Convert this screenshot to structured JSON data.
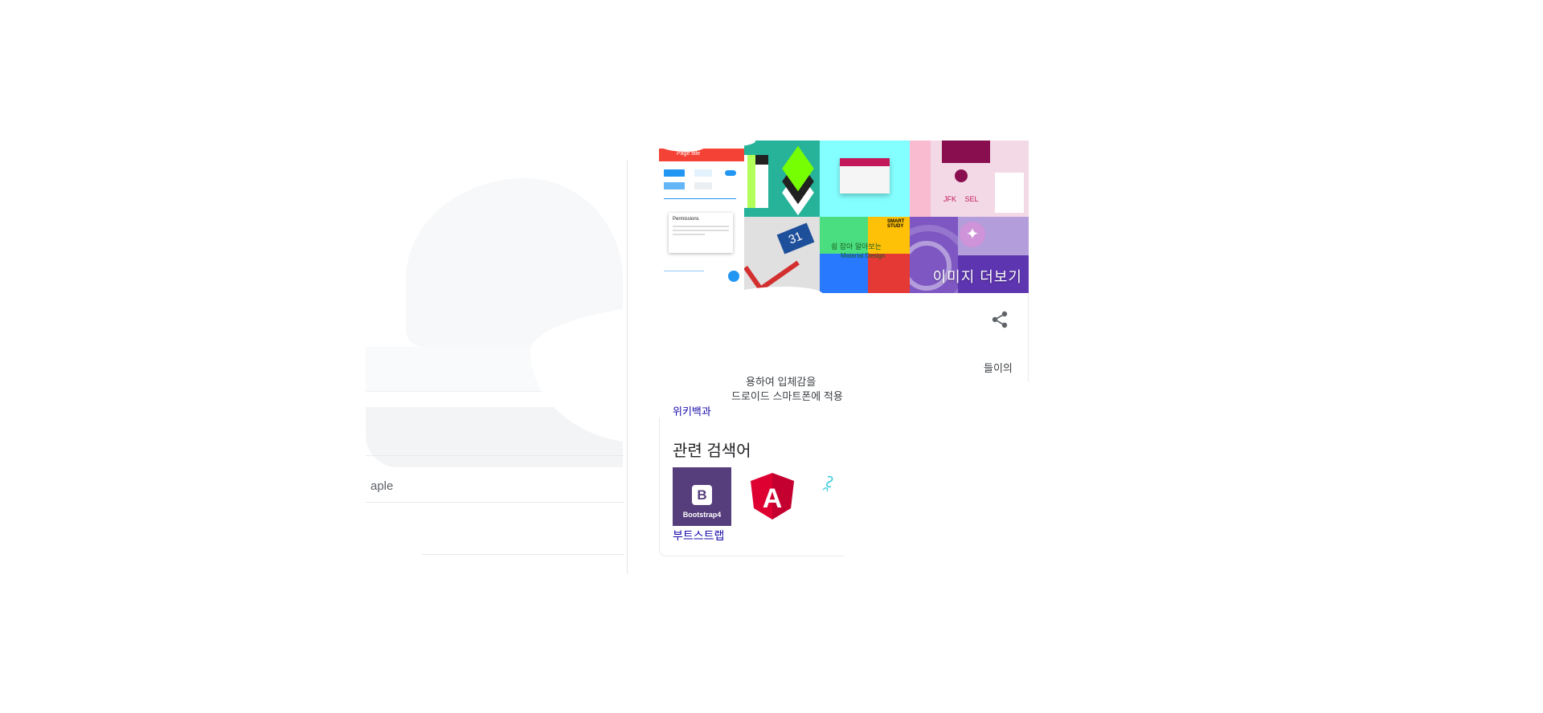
{
  "left_results": {
    "row1_text": "aple",
    "row2_text": "ʼ"
  },
  "knowledge_panel": {
    "more_images_label": "이미지 더보기",
    "thumbs": {
      "calendar_number": "31",
      "smart_study": "SMART STUDY",
      "study_kr": "쉽 잡아 알아보는",
      "material_design": "Material Design",
      "jfk": "JFK",
      "sel": "SEL",
      "mock_title": "Page title",
      "mock_dialog": "Permissions"
    },
    "snippet": {
      "frag_right": "들이의",
      "line1": "용하여 입체감을",
      "line2": "드로이드 스마트폰에 적용",
      "source_link": "위키백과"
    },
    "related": {
      "title": "관련 검색어",
      "items": [
        {
          "label": "부트스트랩",
          "logo_text": "Bootstrap4",
          "logo_letter": "B",
          "color": "#563d7c"
        },
        {
          "label": "",
          "logo_letter": "A",
          "color": "#dd0031"
        }
      ]
    }
  }
}
